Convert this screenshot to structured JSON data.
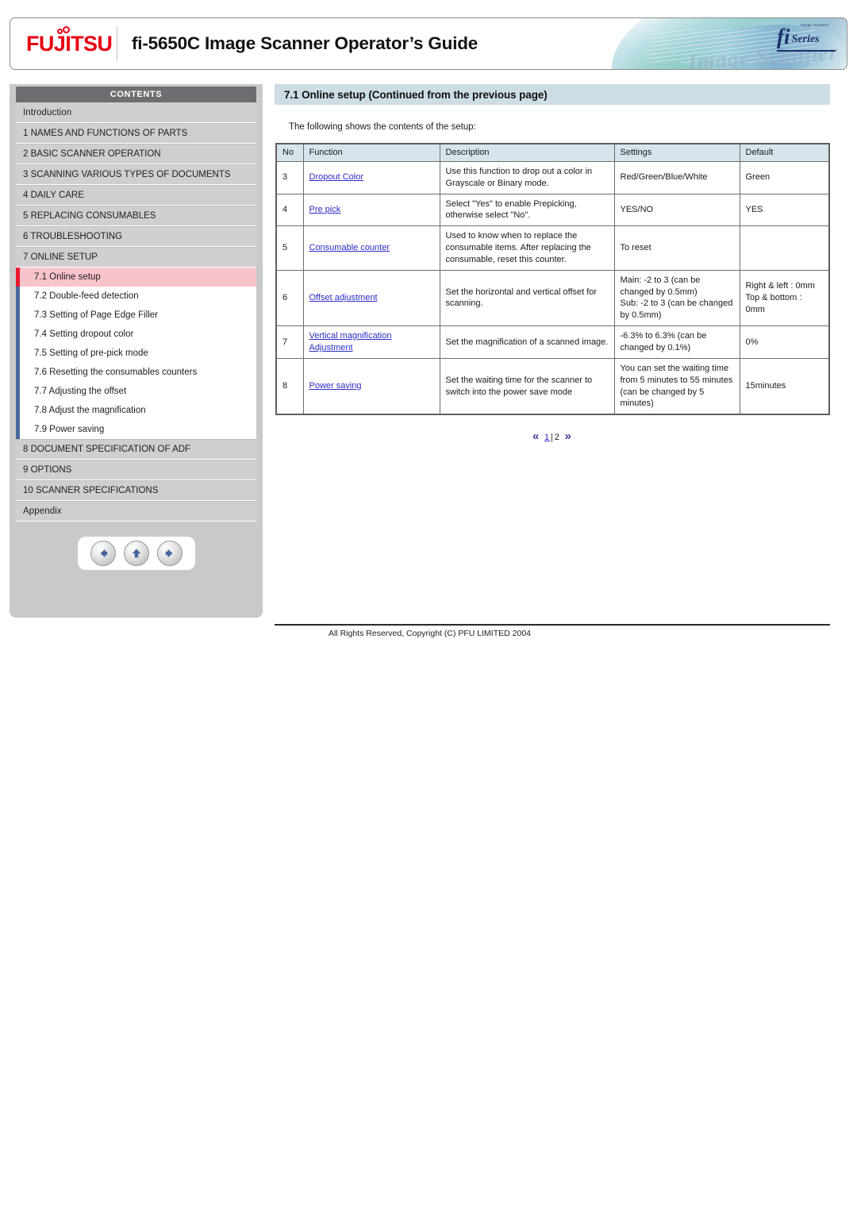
{
  "header": {
    "brand": "FUJITSU",
    "title": "fi-5650C Image Scanner Operator’s Guide",
    "series_mark": "fi",
    "series_word": "Series",
    "series_tiny": "Image Scanner",
    "art_text": "Image Scanner"
  },
  "sidebar": {
    "heading": "CONTENTS",
    "items": [
      {
        "label": "Introduction"
      },
      {
        "label": "1 NAMES AND FUNCTIONS OF PARTS"
      },
      {
        "label": "2 BASIC SCANNER OPERATION"
      },
      {
        "label": "3 SCANNING VARIOUS TYPES OF DOCUMENTS"
      },
      {
        "label": "4 DAILY CARE"
      },
      {
        "label": "5 REPLACING CONSUMABLES"
      },
      {
        "label": "6 TROUBLESHOOTING"
      },
      {
        "label": "7 ONLINE SETUP"
      }
    ],
    "subitems": [
      {
        "label": "7.1 Online setup",
        "active": true
      },
      {
        "label": "7.2 Double-feed detection",
        "active": false
      },
      {
        "label": "7.3 Setting of Page Edge Filler",
        "active": false
      },
      {
        "label": "7.4 Setting dropout color",
        "active": false
      },
      {
        "label": "7.5 Setting of pre-pick mode",
        "active": false
      },
      {
        "label": "7.6 Resetting the consumables counters",
        "active": false
      },
      {
        "label": "7.7 Adjusting the offset",
        "active": false
      },
      {
        "label": "7.8 Adjust the magnification",
        "active": false
      },
      {
        "label": "7.9 Power saving",
        "active": false
      }
    ],
    "items_after": [
      {
        "label": "8 DOCUMENT SPECIFICATION OF ADF"
      },
      {
        "label": "9 OPTIONS"
      },
      {
        "label": "10 SCANNER SPECIFICATIONS"
      },
      {
        "label": "Appendix"
      }
    ],
    "nav_buttons": [
      {
        "name": "back-arrow-button",
        "glyph": "left"
      },
      {
        "name": "up-arrow-button",
        "glyph": "up"
      },
      {
        "name": "forward-arrow-button",
        "glyph": "right"
      }
    ]
  },
  "main": {
    "page_title": "7.1 Online setup (Continued from the previous page)",
    "intro": "The following shows the contents of the setup:",
    "table": {
      "headers": [
        "No",
        "Function",
        "Description",
        "Settings",
        "Default"
      ],
      "rows": [
        {
          "no": "3",
          "function": "Dropout Color",
          "description": "Use this function to drop out a color in Grayscale or Binary mode.",
          "settings": "Red/Green/Blue/White",
          "default": "Green"
        },
        {
          "no": "4",
          "function": "Pre pick",
          "description": "Select \"Yes\" to enable Prepicking, otherwise select \"No\".",
          "settings": "YES/NO",
          "default": "YES"
        },
        {
          "no": "5",
          "function": "Consumable counter",
          "description": "Used to know when to replace the consumable items. After replacing the consumable, reset this counter.",
          "settings": "To reset",
          "default": ""
        },
        {
          "no": "6",
          "function": "Offset adjustment",
          "description": "Set the horizontal and vertical offset for scanning.",
          "settings": "Main: -2 to 3 (can be changed by 0.5mm)\nSub: -2 to 3 (can be changed by 0.5mm)",
          "default": "Right & left : 0mm\nTop & bottom : 0mm"
        },
        {
          "no": "7",
          "function": "Vertical magnification Adjustment",
          "description": "Set the magnification of a scanned image.",
          "settings": "-6.3% to 6.3% (can be changed by 0.1%)",
          "default": "0%"
        },
        {
          "no": "8",
          "function": "Power saving",
          "description": "Set the waiting time for the scanner to switch into the power save mode",
          "settings": "You can set the waiting time from 5 minutes to 55 minutes (can be changed by 5 minutes)",
          "default": "15minutes"
        }
      ]
    },
    "pagination": {
      "prev": "«",
      "next": "»",
      "current": "1",
      "separator": "|",
      "other": "2"
    }
  },
  "footer": {
    "copyright": "All Rights Reserved, Copyright (C) PFU LIMITED 2004"
  },
  "colors": {
    "brand_red": "#e60012",
    "title_bar": "#cddde5",
    "table_header": "#d5e5eb",
    "active_item": "#f9c3cc",
    "active_bar": "#e8192c",
    "sub_bar": "#4a6a9c",
    "link": "#2b2bc8"
  }
}
